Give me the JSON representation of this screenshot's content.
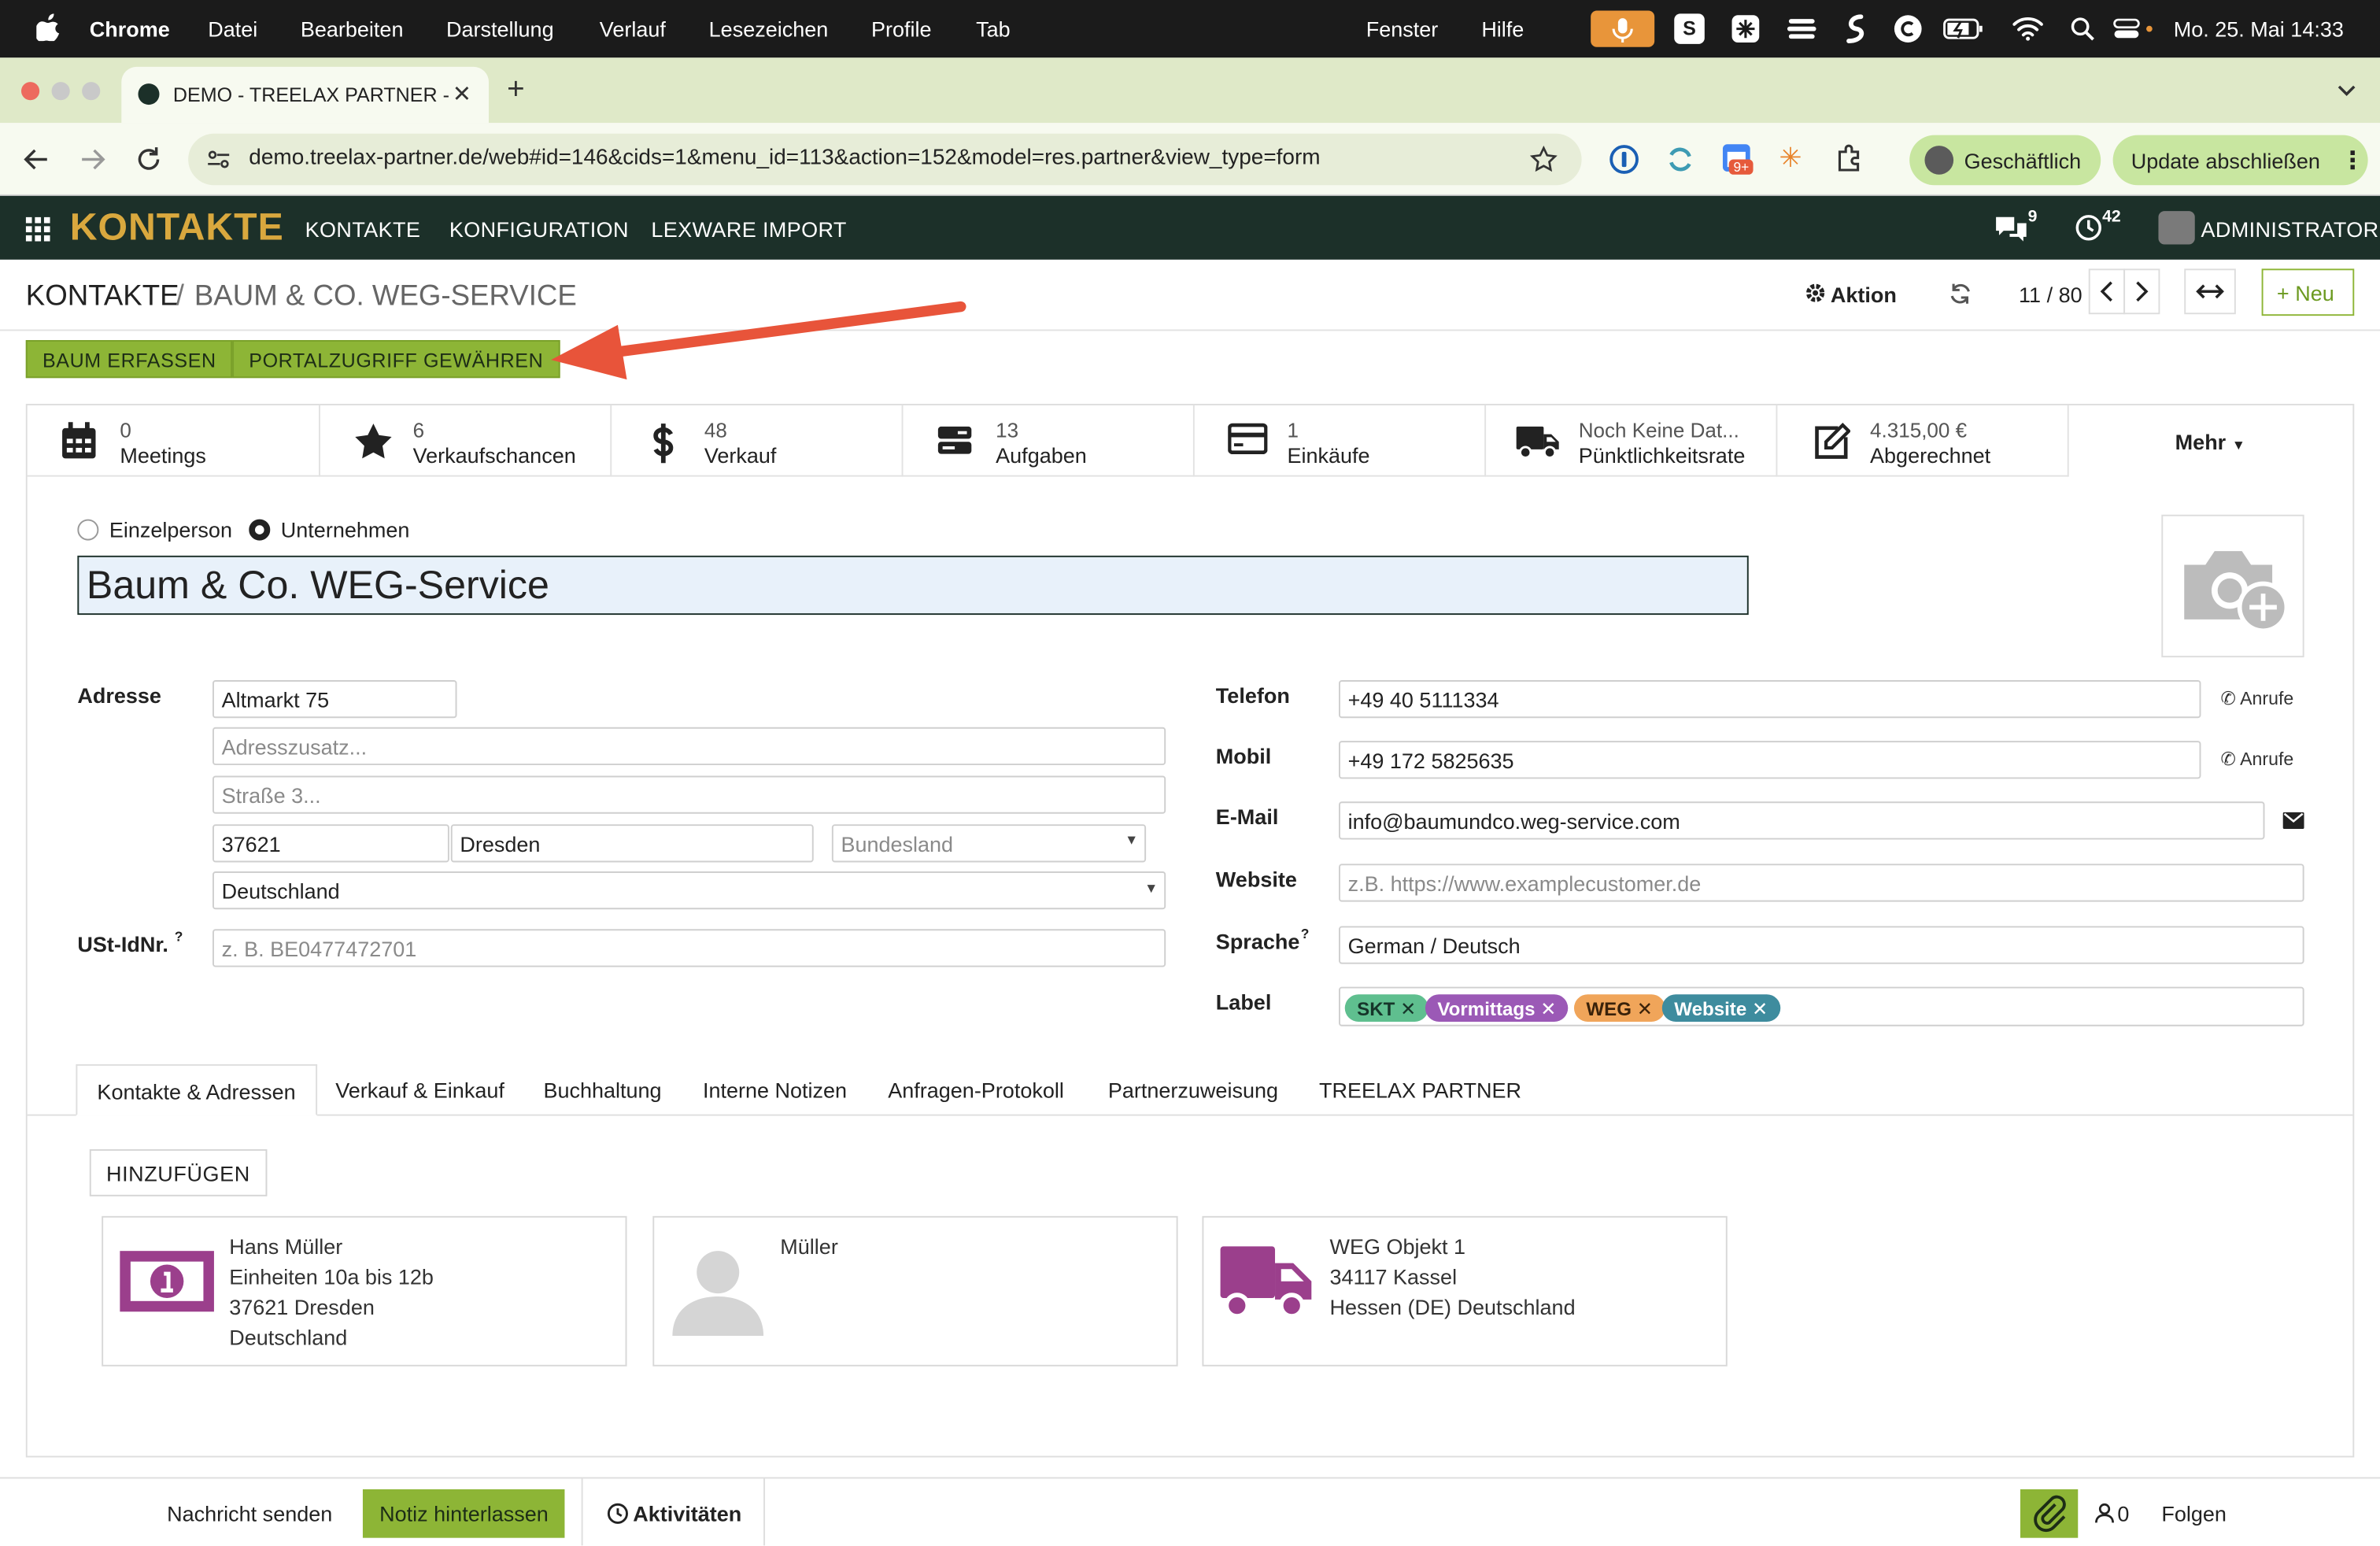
{
  "macos": {
    "app": "Chrome",
    "menu": [
      "Datei",
      "Bearbeiten",
      "Darstellung",
      "Verlauf",
      "Lesezeichen",
      "Profile",
      "Tab",
      "Fenster",
      "Hilfe"
    ],
    "clock": "Mo. 25. Mai  14:33"
  },
  "browser": {
    "tab_title": "DEMO - TREELAX PARTNER -",
    "url": "demo.treelax-partner.de/web#id=146&cids=1&menu_id=113&action=152&model=res.partner&view_type=form",
    "profile_label": "Geschäftlich",
    "update_label": "Update abschließen",
    "ext_badge": "9+"
  },
  "odoo_nav": {
    "app_name": "KONTAKTE",
    "items": [
      "KONTAKTE",
      "KONFIGURATION",
      "LEXWARE IMPORT"
    ],
    "messages_count": "9",
    "activities_count": "42",
    "user": "ADMINISTRATOR"
  },
  "control_panel": {
    "breadcrumb_root": "KONTAKTE",
    "breadcrumb_sep": "/",
    "breadcrumb_current": "BAUM & CO. WEG-SERVICE",
    "action": "Aktion",
    "pager": "11 / 80",
    "new": "Neu"
  },
  "header_buttons": [
    "BAUM ERFASSEN",
    "PORTALZUGRIFF GEWÄHREN"
  ],
  "stats": [
    {
      "value": "0",
      "label": "Meetings",
      "icon": "calendar-icon"
    },
    {
      "value": "6",
      "label": "Verkaufschancen",
      "icon": "star-icon"
    },
    {
      "value": "48",
      "label": "Verkauf",
      "icon": "dollar-icon"
    },
    {
      "value": "13",
      "label": "Aufgaben",
      "icon": "tasks-icon"
    },
    {
      "value": "1",
      "label": "Einkäufe",
      "icon": "credit-card-icon"
    },
    {
      "value": "Noch Keine Dat...",
      "label": "Pünktlichkeitsrate",
      "icon": "truck-icon"
    },
    {
      "value": "4.315,00 €",
      "label": "Abgerechnet",
      "icon": "edit-icon"
    }
  ],
  "more": "Mehr",
  "company_type": {
    "individual": "Einzelperson",
    "company": "Unternehmen"
  },
  "name": "Baum & Co. WEG-Service",
  "address": {
    "label": "Adresse",
    "street": "Altmarkt 75",
    "street2_placeholder": "Adresszusatz...",
    "street3_placeholder": "Straße 3...",
    "zip": "37621",
    "city": "Dresden",
    "state_placeholder": "Bundesland",
    "country": "Deutschland"
  },
  "vat": {
    "label": "USt-IdNr.",
    "help": "?",
    "placeholder": "z. B. BE0477472701"
  },
  "right": {
    "phone_label": "Telefon",
    "phone": "+49 40 5111334",
    "mobile_label": "Mobil",
    "mobile": "+49 172 5825635",
    "call": "Anrufe",
    "email_label": "E-Mail",
    "email": "info@baumundco.weg-service.com",
    "website_label": "Website",
    "website_placeholder": "z.B. https://www.examplecustomer.de",
    "lang_label": "Sprache",
    "lang_help": "?",
    "lang": "German / Deutsch",
    "tags_label": "Label",
    "tags": [
      {
        "name": "SKT",
        "remove": "✕",
        "color": "#5fbf8f"
      },
      {
        "name": "Vormittags",
        "remove": "✕",
        "color": "#9b59b6"
      },
      {
        "name": "WEG",
        "remove": "✕",
        "color": "#f0a55a"
      },
      {
        "name": "Website",
        "remove": "✕",
        "color": "#3e8c9e"
      }
    ]
  },
  "notebook_tabs": [
    "Kontakte & Adressen",
    "Verkauf & Einkauf",
    "Buchhaltung",
    "Interne Notizen",
    "Anfragen-Protokoll",
    "Partnerzuweisung",
    "TREELAX PARTNER"
  ],
  "add_button": "HINZUFÜGEN",
  "contacts": [
    {
      "lines": [
        "Hans Müller",
        "Einheiten 10a bis 12b",
        "37621 Dresden",
        "Deutschland"
      ],
      "icon": "invoice-money-icon"
    },
    {
      "lines": [
        "Müller"
      ],
      "icon": "avatar-icon"
    },
    {
      "lines": [
        "WEG Objekt 1",
        "34117 Kassel",
        "Hessen (DE) Deutschland"
      ],
      "icon": "delivery-truck-icon"
    }
  ],
  "chatter": {
    "send": "Nachricht senden",
    "note": "Notiz hinterlassen",
    "activities": "Aktivitäten",
    "followers": "0",
    "follow": "Folgen"
  },
  "colors": {
    "odoo_nav_bg": "#1c3029",
    "odoo_brand": "#d9a83e",
    "button_green": "#8db536",
    "annotation_arrow": "#e8543a",
    "browser_accent": "#c8e6a0"
  }
}
